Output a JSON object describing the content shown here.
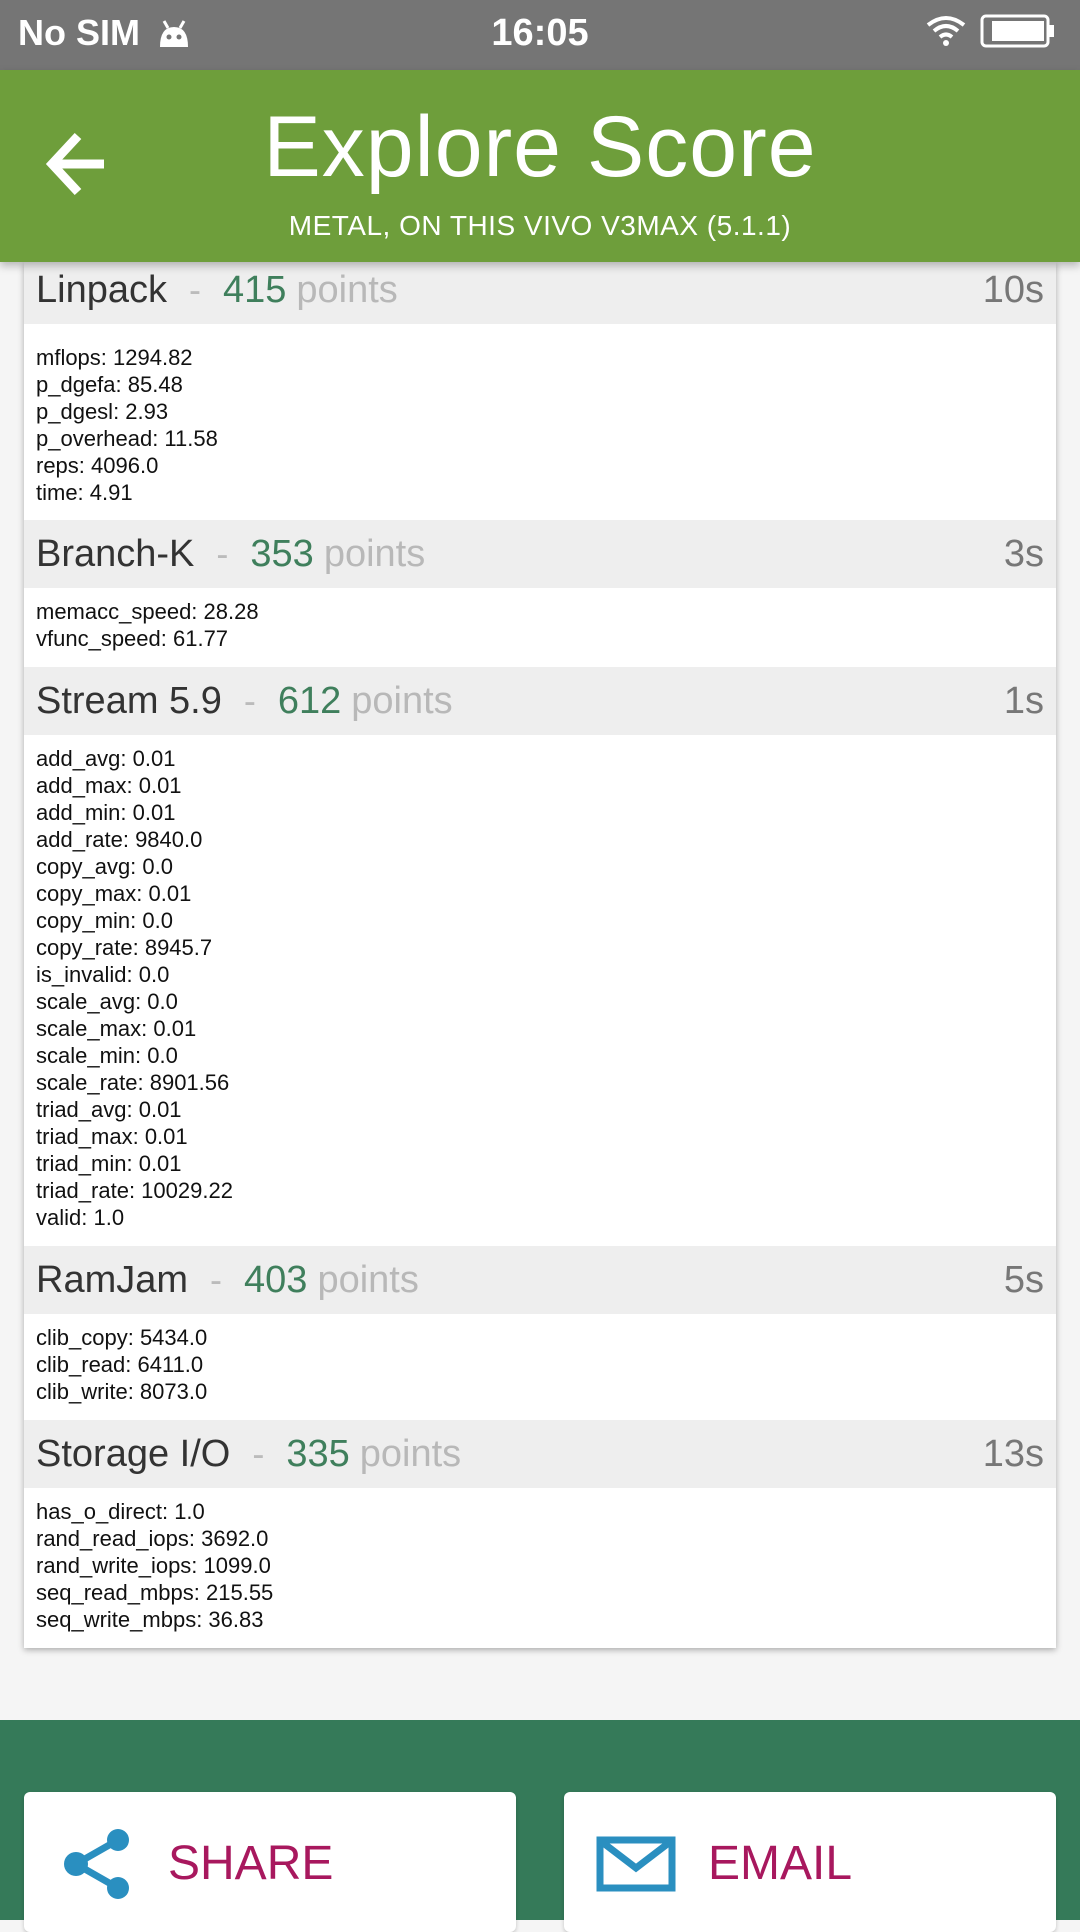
{
  "status_bar": {
    "carrier": "No SIM",
    "time": "16:05"
  },
  "header": {
    "title": "Explore Score",
    "subtitle": "METAL, ON THIS VIVO V3MAX (5.1.1)"
  },
  "sections": [
    {
      "name": "Linpack",
      "dash": "-",
      "score": "415",
      "points_label": "points",
      "duration": "10s",
      "metrics": [
        "mflops: 1294.82",
        "p_dgefa: 85.48",
        "p_dgesl: 2.93",
        "p_overhead: 11.58",
        "reps: 4096.0",
        "time: 4.91"
      ]
    },
    {
      "name": "Branch-K",
      "dash": "-",
      "score": "353",
      "points_label": "points",
      "duration": "3s",
      "metrics": [
        "memacc_speed: 28.28",
        "vfunc_speed: 61.77"
      ]
    },
    {
      "name": "Stream 5.9",
      "dash": "-",
      "score": "612",
      "points_label": "points",
      "duration": "1s",
      "metrics": [
        "add_avg: 0.01",
        "add_max: 0.01",
        "add_min: 0.01",
        "add_rate: 9840.0",
        "copy_avg: 0.0",
        "copy_max: 0.01",
        "copy_min: 0.0",
        "copy_rate: 8945.7",
        "is_invalid: 0.0",
        "scale_avg: 0.0",
        "scale_max: 0.01",
        "scale_min: 0.0",
        "scale_rate: 8901.56",
        "triad_avg: 0.01",
        "triad_max: 0.01",
        "triad_min: 0.01",
        "triad_rate: 10029.22",
        "valid: 1.0"
      ]
    },
    {
      "name": "RamJam",
      "dash": "-",
      "score": "403",
      "points_label": "points",
      "duration": "5s",
      "metrics": [
        "clib_copy: 5434.0",
        "clib_read: 6411.0",
        "clib_write: 8073.0"
      ]
    },
    {
      "name": "Storage I/O",
      "dash": "-",
      "score": "335",
      "points_label": "points",
      "duration": "13s",
      "metrics": [
        "has_o_direct: 1.0",
        "rand_read_iops: 3692.0",
        "rand_write_iops: 1099.0",
        "seq_read_mbps: 215.55",
        "seq_write_mbps: 36.83"
      ]
    }
  ],
  "actions": {
    "share_label": "SHARE",
    "email_label": "EMAIL"
  },
  "icons": {
    "back": "arrow-back-icon",
    "share": "share-icon",
    "email": "email-icon",
    "notification": "android-icon",
    "wifi": "wifi-icon",
    "battery": "battery-icon"
  },
  "colors": {
    "appbar": "#6e9e3b",
    "score": "#3f7f5c",
    "bottom_bar": "#357a59",
    "action_text": "#a8185e",
    "action_icon": "#2a8fc0"
  }
}
